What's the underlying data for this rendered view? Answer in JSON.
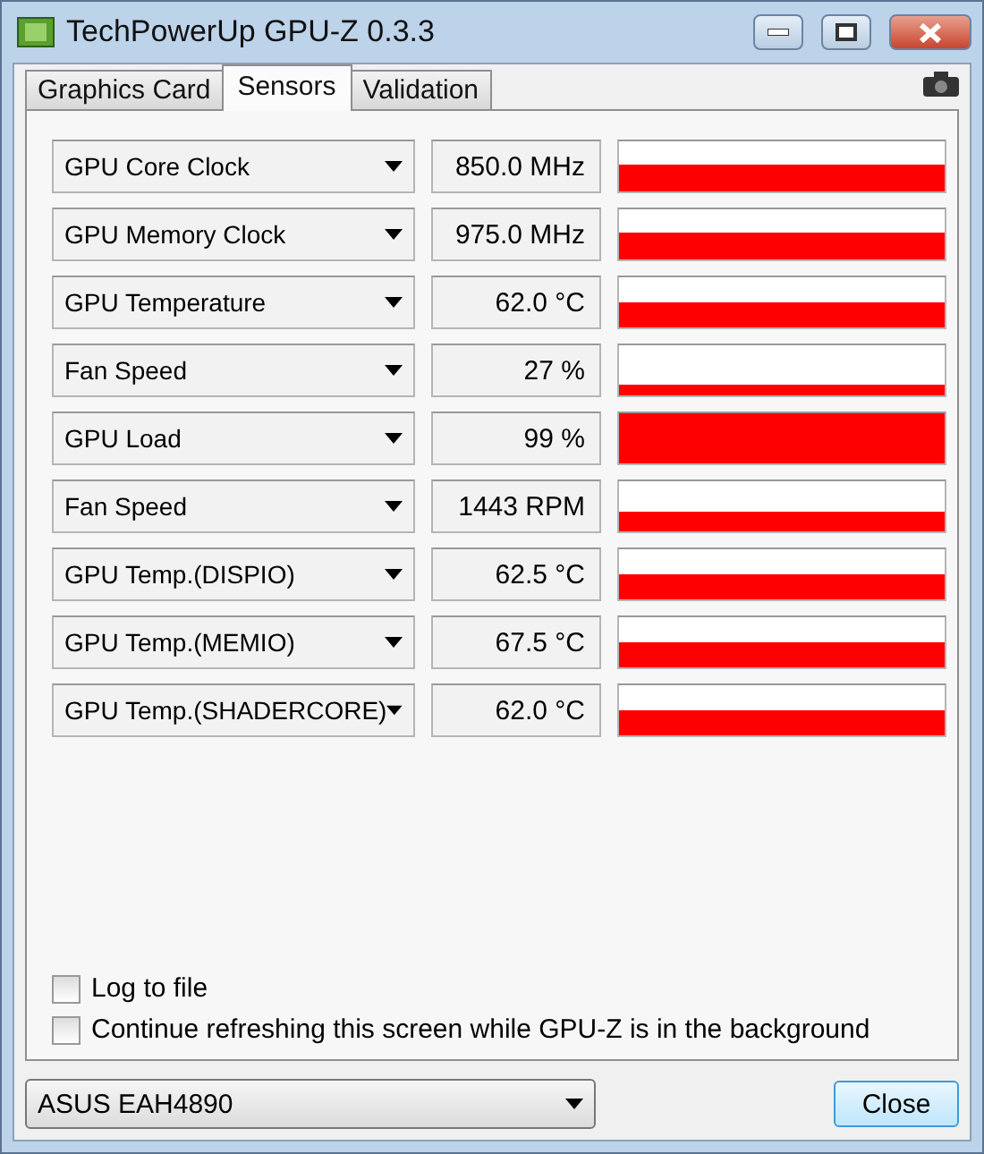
{
  "window": {
    "title": "TechPowerUp GPU-Z 0.3.3"
  },
  "tabs": [
    {
      "label": "Graphics Card",
      "selected": false
    },
    {
      "label": "Sensors",
      "selected": true
    },
    {
      "label": "Validation",
      "selected": false
    }
  ],
  "sensors": [
    {
      "name": "GPU Core Clock",
      "reading": "850.0 MHz"
    },
    {
      "name": "GPU Memory Clock",
      "reading": "975.0 MHz"
    },
    {
      "name": "GPU Temperature",
      "reading": "62.0 °C"
    },
    {
      "name": "Fan Speed",
      "reading": "27 %"
    },
    {
      "name": "GPU Load",
      "reading": "99 %"
    },
    {
      "name": "Fan Speed",
      "reading": "1443 RPM"
    },
    {
      "name": "GPU Temp.(DISPIO)",
      "reading": "62.5 °C"
    },
    {
      "name": "GPU Temp.(MEMIO)",
      "reading": "67.5 °C"
    },
    {
      "name": "GPU Temp.(SHADERCORE)",
      "reading": "62.0 °C"
    }
  ],
  "options": [
    {
      "label": "Log to file",
      "checked": false
    },
    {
      "label": "Continue refreshing this screen while GPU-Z is in the background",
      "checked": false
    }
  ],
  "card_select": {
    "value": "ASUS EAH4890"
  },
  "buttons": [
    "Close"
  ]
}
